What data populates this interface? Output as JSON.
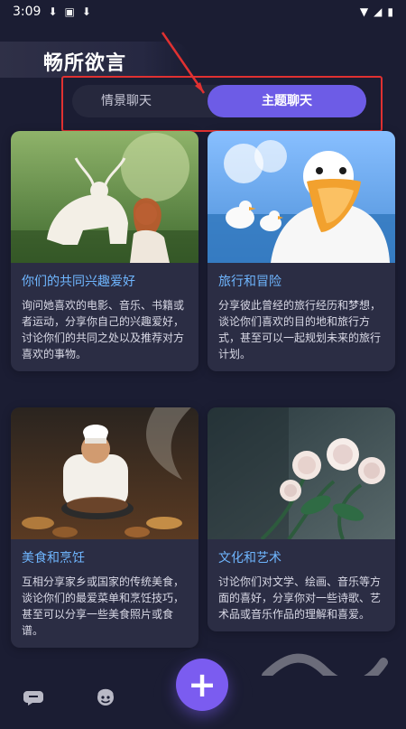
{
  "status": {
    "time": "3:09",
    "icons": [
      "download-icon",
      "a-box-icon",
      "download-icon"
    ],
    "right_icons": [
      "wifi-icon",
      "signal-icon",
      "battery-icon"
    ]
  },
  "header": {
    "title": "畅所欲言"
  },
  "tabs": [
    {
      "label": "情景聊天"
    },
    {
      "label": "主题聊天"
    }
  ],
  "cards": [
    {
      "title": "你们的共同兴趣爱好",
      "desc": "询问她喜欢的电影、音乐、书籍或者运动，分享你自己的兴趣爱好，讨论你们的共同之处以及推荐对方喜欢的事物。",
      "image": "deer-woman-image"
    },
    {
      "title": "旅行和冒险",
      "desc": "分享彼此曾经的旅行经历和梦想，谈论你们喜欢的目的地和旅行方式，甚至可以一起规划未来的旅行计划。",
      "image": "duck-image"
    },
    {
      "title": "美食和烹饪",
      "desc": "互相分享家乡或国家的传统美食，谈论你们的最爱菜单和烹饪技巧，甚至可以分享一些美食照片或食谱。",
      "image": "chef-image"
    },
    {
      "title": "文化和艺术",
      "desc": "讨论你们对文学、绘画、音乐等方面的喜好，分享你对一些诗歌、艺术品或音乐作品的理解和喜爱。",
      "image": "roses-image"
    }
  ],
  "bottom_nav": [
    {
      "icon": "chat-icon"
    },
    {
      "icon": "persona-icon"
    }
  ],
  "fab": {
    "icon": "plus-icon"
  },
  "colors": {
    "accent": "#6d5ce6",
    "title_blue": "#6fb6ff",
    "bg": "#1b1d33",
    "annotation_red": "#e03131"
  }
}
